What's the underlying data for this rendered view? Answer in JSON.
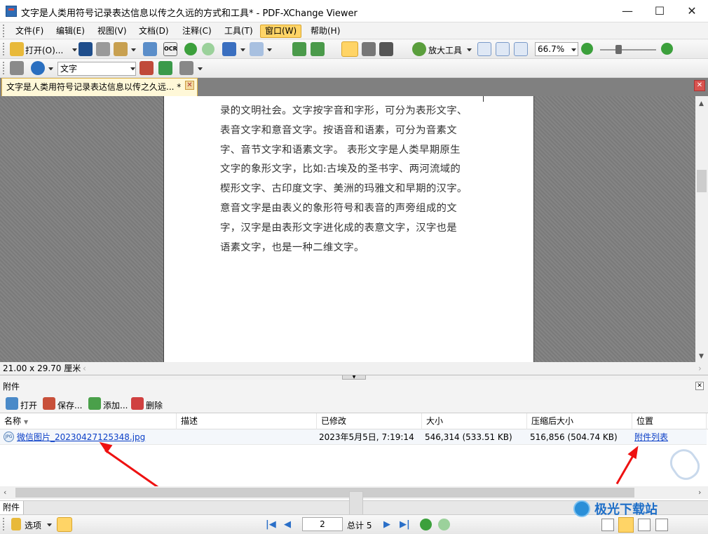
{
  "window": {
    "title": "文字是人类用符号记录表达信息以传之久远的方式和工具* - PDF-XChange Viewer",
    "minimize": "—",
    "maximize": "☐",
    "close": "✕"
  },
  "menu": [
    "文件(F)",
    "编辑(E)",
    "视图(V)",
    "文档(D)",
    "注释(C)",
    "工具(T)",
    "窗口(W)",
    "帮助(H)"
  ],
  "toolbar1": {
    "open_label": "打开(O)...",
    "ocr_label": "OCR",
    "zoom_tool_label": "放大工具",
    "zoom_value": "66.7%"
  },
  "toolbar2": {
    "text_mode": "文字"
  },
  "doc_tab": {
    "label": "文字是人类用符号记录表达信息以传之久远...  *"
  },
  "page": {
    "lines": [
      "录的文明社会。文字按字音和字形，可分为表形文字、",
      "表音文字和意音文字。按语音和语素，可分为音素文",
      "字、音节文字和语素文字。 表形文字是人类早期原生",
      "文字的象形文字，比如:古埃及的圣书字、两河流域的",
      "楔形文字、古印度文字、美洲的玛雅文和早期的汉字。",
      "意音文字是由表义的象形符号和表音的声旁组成的文",
      "字，汉字是由表形文字进化成的表意文字，汉字也是",
      "语素文字，也是一种二维文字。"
    ]
  },
  "status": {
    "page_size": "21.00 x 29.70 厘米"
  },
  "attachments": {
    "panel_title": "附件",
    "toolbar": {
      "open": "打开",
      "save": "保存...",
      "add": "添加...",
      "delete": "删除"
    },
    "columns": [
      "名称",
      "描述",
      "已修改",
      "大小",
      "压缩后大小",
      "位置"
    ],
    "rows": [
      {
        "name": "微信图片_20230427125348.jpg",
        "description": "",
        "modified": "2023年5月5日, 7:19:14",
        "size": "546,314 (533.51 KB)",
        "compressed": "516,856 (504.74 KB)",
        "location": "附件列表"
      }
    ],
    "pane_tab": "附件"
  },
  "bottom": {
    "options_label": "选项",
    "current_page": "2",
    "total_label": "总计 5"
  },
  "watermark": {
    "text": "极光下载站"
  },
  "colors": {
    "accent": "#ffd466",
    "tab_bg": "#fff8d8",
    "link": "#0b3fc7",
    "annotation_arrow": "#e11111"
  }
}
